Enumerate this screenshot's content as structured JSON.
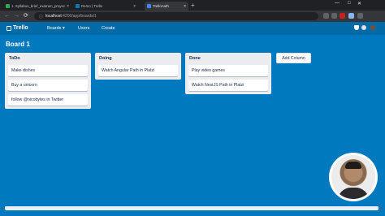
{
  "browser": {
    "tabs": [
      {
        "label": "1. Syllabus_brief_examen_proyec",
        "favicon_color": "#34a853"
      },
      {
        "label": "Demo | Trello",
        "favicon_color": "#0079bf"
      },
      {
        "label": "TrelloAuth",
        "favicon_color": "#4285f4"
      }
    ],
    "new_tab_glyph": "+",
    "window_controls": {
      "minimize": "—",
      "maximize": "□",
      "close": "✕"
    },
    "nav": {
      "back": "←",
      "forward": "→",
      "reload": "⟳"
    },
    "address": {
      "host": "localhost",
      "path": ":4200/app/boards/1"
    },
    "toolbar_icons": [
      "share-icon",
      "star-icon",
      "extension-icon",
      "profile-icon",
      "menu-icon"
    ]
  },
  "app": {
    "logo_text": "Trello",
    "nav_links": [
      "Boards ▾",
      "Users",
      "Create"
    ],
    "nav_icons": [
      "bell-icon",
      "info-icon",
      "avatar-icon"
    ]
  },
  "board": {
    "title": "Board 1",
    "lists": [
      {
        "title": "ToDo",
        "cards": [
          "Make dishes",
          "Buy a unicorn",
          "follow @nicobytes in Twitter"
        ]
      },
      {
        "title": "Doing",
        "cards": [
          "Watch Angular Path in Platzi"
        ]
      },
      {
        "title": "Done",
        "cards": [
          "Play video games",
          "Watch NestJS Path in Platzi"
        ]
      }
    ],
    "add_column_label": "Add Column"
  },
  "colors": {
    "board_bg": "#0079bf",
    "navbar_bg": "#026aa7",
    "list_bg": "#ebecf0"
  }
}
